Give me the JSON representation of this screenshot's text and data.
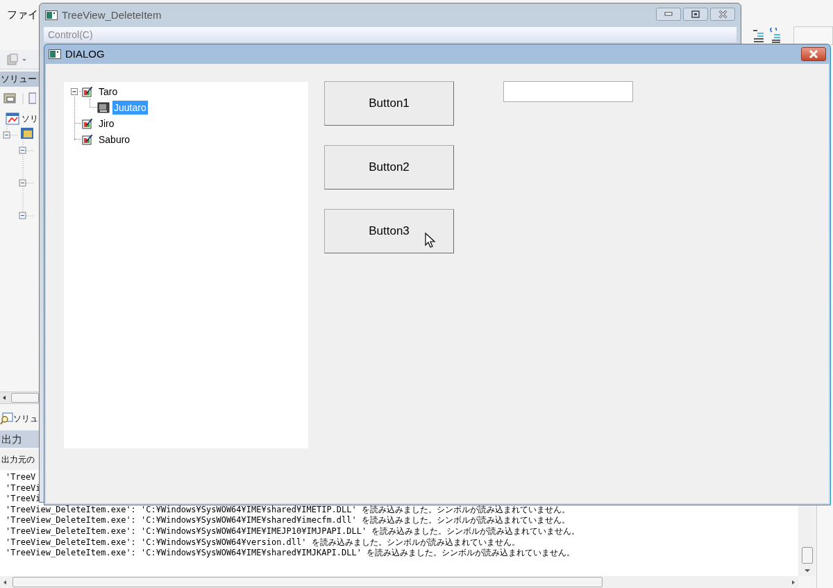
{
  "ide": {
    "menu": [
      "ファイ"
    ],
    "solution_pane": {
      "title": "ソリュー",
      "root": "ソリ"
    },
    "solution_tab": "ソリュ",
    "output": {
      "title": "出力",
      "source_label": "出力元の",
      "lines": [
        "'TreeV",
        "'TreeVi",
        "'TreeVi",
        "'TreeView_DeleteItem.exe': 'C:¥Windows¥SysWOW64¥IME¥shared¥IMETIP.DLL' を読み込みました。シンボルが読み込まれていません。",
        "'TreeView_DeleteItem.exe': 'C:¥Windows¥SysWOW64¥IME¥shared¥imecfm.dll' を読み込みました。シンボルが読み込まれていません。",
        "'TreeView_DeleteItem.exe': 'C:¥Windows¥SysWOW64¥IME¥IMEJP10¥IMJPAPI.DLL' を読み込みました。シンボルが読み込まれていません。",
        "'TreeView_DeleteItem.exe': 'C:¥Windows¥SysWOW64¥version.dll' を読み込みました。シンボルが読み込まれていません。",
        "'TreeView_DeleteItem.exe': 'C:¥Windows¥SysWOW64¥IME¥shared¥IMJKAPI.DLL' を読み込みました。シンボルが読み込まれていません。"
      ]
    }
  },
  "app_window": {
    "title": "TreeView_DeleteItem",
    "menu": [
      "Control(C)"
    ]
  },
  "dialog": {
    "title": "DIALOG",
    "tree": [
      {
        "label": "Taro",
        "selected": false,
        "expanded": true,
        "children": [
          {
            "label": "Juutaro",
            "selected": true
          }
        ]
      },
      {
        "label": "Jiro",
        "selected": false
      },
      {
        "label": "Saburo",
        "selected": false
      }
    ],
    "buttons": [
      "Button1",
      "Button2",
      "Button3"
    ]
  }
}
